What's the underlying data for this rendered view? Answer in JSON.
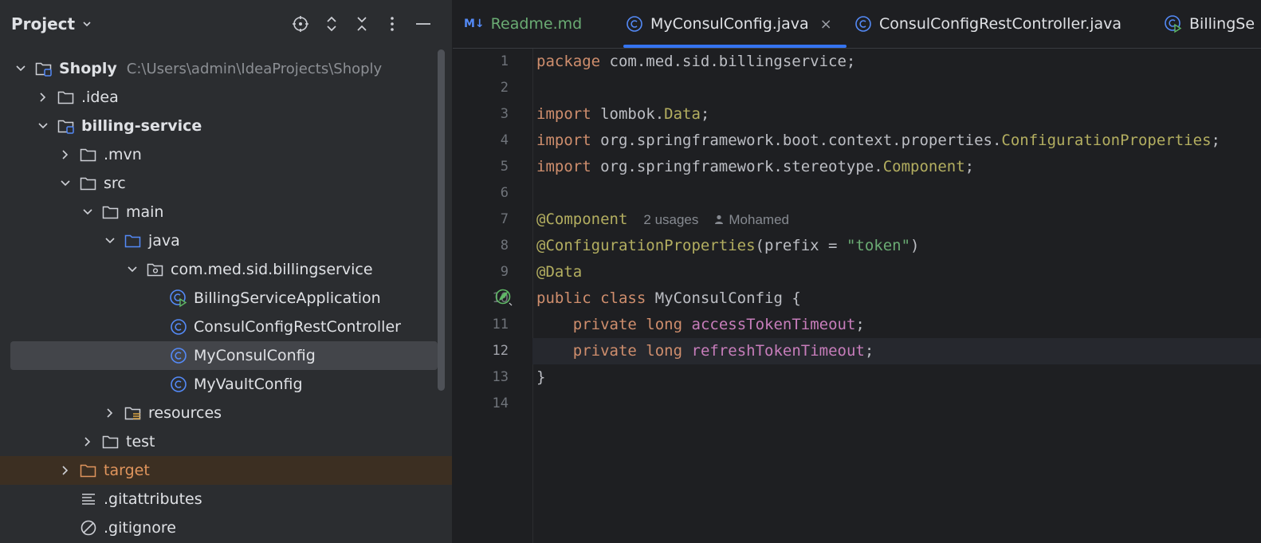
{
  "project_panel": {
    "title": "Project",
    "toolbar_icons": [
      "locate-icon",
      "expand-all-icon",
      "collapse-all-icon",
      "more-options-icon",
      "hide-panel-icon"
    ],
    "tree": [
      {
        "label": "Shoply",
        "path": "C:\\Users\\admin\\IdeaProjects\\Shoply",
        "icon": "module-folder-icon",
        "expanded": true
      },
      {
        "label": ".idea",
        "icon": "folder-icon",
        "expanded": false
      },
      {
        "label": "billing-service",
        "icon": "module-folder-icon",
        "expanded": true
      },
      {
        "label": ".mvn",
        "icon": "folder-icon",
        "expanded": false
      },
      {
        "label": "src",
        "icon": "folder-icon",
        "expanded": true
      },
      {
        "label": "main",
        "icon": "folder-icon",
        "expanded": true
      },
      {
        "label": "java",
        "icon": "source-folder-icon",
        "expanded": true
      },
      {
        "label": "com.med.sid.billingservice",
        "icon": "package-icon",
        "expanded": true
      },
      {
        "label": "BillingServiceApplication",
        "icon": "spring-boot-class-icon"
      },
      {
        "label": "ConsulConfigRestController",
        "icon": "class-icon"
      },
      {
        "label": "MyConsulConfig",
        "icon": "class-icon",
        "selected": true
      },
      {
        "label": "MyVaultConfig",
        "icon": "class-icon"
      },
      {
        "label": "resources",
        "icon": "resources-folder-icon",
        "expanded": false
      },
      {
        "label": "test",
        "icon": "folder-icon",
        "expanded": false
      },
      {
        "label": "target",
        "icon": "excluded-folder-icon",
        "expanded": false
      },
      {
        "label": ".gitattributes",
        "icon": "text-file-icon"
      },
      {
        "label": ".gitignore",
        "icon": "ignore-file-icon"
      }
    ]
  },
  "editor": {
    "tabs": [
      {
        "label": "Readme.md",
        "icon": "markdown-icon",
        "icon_text": "M↓"
      },
      {
        "label": "MyConsulConfig.java",
        "icon": "class-icon",
        "active": true,
        "close": "×"
      },
      {
        "label": "ConsulConfigRestController.java",
        "icon": "class-icon"
      },
      {
        "label": "BillingSe",
        "icon": "spring-boot-class-icon"
      }
    ],
    "line_numbers": [
      "1",
      "2",
      "3",
      "4",
      "5",
      "6",
      "7",
      "8",
      "9",
      "10",
      "11",
      "12",
      "13",
      "14"
    ],
    "current_line": "12",
    "inlay_hints": {
      "usages": "2 usages",
      "author": "Mohamed"
    },
    "code": {
      "l1": [
        "package",
        " com.med.sid.billingservice;"
      ],
      "l3": [
        "import",
        " lombok.",
        "Data",
        ";"
      ],
      "l4": [
        "import",
        " org.springframework.boot.context.properties.",
        "ConfigurationProperties",
        ";"
      ],
      "l5": [
        "import",
        " org.springframework.stereotype.",
        "Component",
        ";"
      ],
      "l7": [
        "@Component"
      ],
      "l8": [
        "@ConfigurationProperties",
        "(prefix = ",
        "\"token\"",
        ")"
      ],
      "l9": [
        "@Data"
      ],
      "l10": [
        "public",
        " ",
        "class",
        " MyConsulConfig {"
      ],
      "l11": [
        "    ",
        "private",
        " ",
        "long",
        " ",
        "accessTokenTimeout",
        ";"
      ],
      "l12": [
        "    ",
        "private",
        " ",
        "long",
        " ",
        "refreshTokenTimeout",
        ";"
      ],
      "l13": [
        "}"
      ]
    }
  },
  "colors": {
    "background": "#1e1f22",
    "panel": "#2b2d30",
    "selection": "#43454a",
    "accent": "#3574f0",
    "keyword": "#cf8e6d",
    "annotation": "#b3ae60",
    "string": "#6aab73",
    "field": "#c77dbb",
    "excluded": "#e0955d"
  }
}
